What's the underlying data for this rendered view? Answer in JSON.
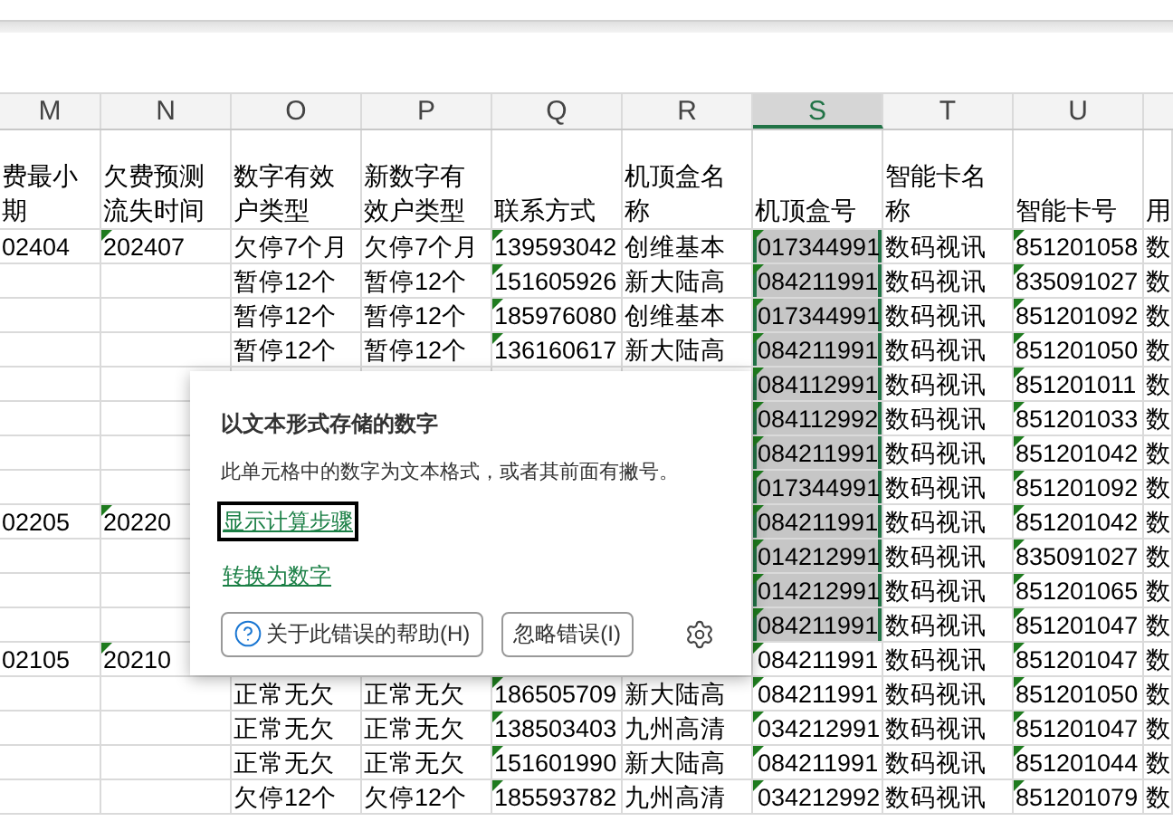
{
  "columns": [
    {
      "letter": "M",
      "header": [
        "费最小",
        "期"
      ],
      "selected": false
    },
    {
      "letter": "N",
      "header": [
        "欠费预测",
        "流失时间"
      ],
      "error_mark": true,
      "selected": false
    },
    {
      "letter": "O",
      "header": [
        "数字有效",
        "户类型"
      ],
      "selected": false
    },
    {
      "letter": "P",
      "header": [
        "新数字有",
        "效户类型"
      ],
      "selected": false
    },
    {
      "letter": "Q",
      "header": [
        "联系方式"
      ],
      "error_mark": true,
      "selected": false
    },
    {
      "letter": "R",
      "header": [
        "机顶盒名",
        "称"
      ],
      "selected": false
    },
    {
      "letter": "S",
      "header": [
        "机顶盒号"
      ],
      "error_mark": true,
      "selected": true
    },
    {
      "letter": "T",
      "header": [
        "智能卡名",
        "称"
      ],
      "selected": false
    },
    {
      "letter": "U",
      "header": [
        "智能卡号"
      ],
      "error_mark": true,
      "selected": false
    },
    {
      "header": [
        "用"
      ]
    }
  ],
  "rows": [
    {
      "selected": true,
      "cells": [
        "02404",
        "202407",
        "欠停7个月",
        "欠停7个月",
        "139593042",
        "创维基本",
        "017344991",
        "数码视讯",
        "851201058",
        "数"
      ]
    },
    {
      "selected": true,
      "cells": [
        null,
        null,
        "暂停12个",
        "暂停12个",
        "151605926",
        "新大陆高",
        "084211991",
        "数码视讯",
        "835091027",
        "数"
      ]
    },
    {
      "selected": true,
      "cells": [
        null,
        null,
        "暂停12个",
        "暂停12个",
        "185976080",
        "创维基本",
        "017344991",
        "数码视讯",
        "851201092",
        "数"
      ]
    },
    {
      "selected": true,
      "cells": [
        null,
        null,
        "暂停12个",
        "暂停12个",
        "136160617",
        "新大陆高",
        "084211991",
        "数码视讯",
        "851201050",
        "数"
      ]
    },
    {
      "selected": true,
      "cells": [
        null,
        null,
        null,
        null,
        null,
        null,
        "084112991",
        "数码视讯",
        "851201011",
        "数"
      ]
    },
    {
      "selected": true,
      "cells": [
        null,
        null,
        null,
        null,
        null,
        null,
        "084112992",
        "数码视讯",
        "851201033",
        "数"
      ]
    },
    {
      "selected": true,
      "cells": [
        null,
        null,
        null,
        null,
        null,
        null,
        "084211991",
        "数码视讯",
        "851201042",
        "数"
      ]
    },
    {
      "selected": true,
      "cells": [
        null,
        null,
        null,
        null,
        null,
        null,
        "017344991",
        "数码视讯",
        "851201092",
        "数"
      ]
    },
    {
      "selected": true,
      "cells": [
        "02205",
        "20220",
        null,
        null,
        null,
        null,
        "084211991",
        "数码视讯",
        "851201042",
        "数"
      ]
    },
    {
      "selected": true,
      "cells": [
        null,
        null,
        null,
        null,
        null,
        null,
        "014212991",
        "数码视讯",
        "835091027",
        "数"
      ]
    },
    {
      "selected": true,
      "cells": [
        null,
        null,
        null,
        null,
        null,
        null,
        "014212991",
        "数码视讯",
        "851201065",
        "数"
      ]
    },
    {
      "selected": true,
      "cells": [
        null,
        null,
        null,
        null,
        null,
        null,
        "084211991",
        "数码视讯",
        "851201047",
        "数"
      ]
    },
    {
      "selected": false,
      "cells": [
        "02105",
        "20210",
        null,
        null,
        null,
        null,
        "084211991",
        "数码视讯",
        "851201047",
        "数"
      ]
    },
    {
      "selected": false,
      "cells": [
        null,
        null,
        "正常无欠",
        "正常无欠",
        "186505709",
        "新大陆高",
        "084211991",
        "数码视讯",
        "851201050",
        "数"
      ]
    },
    {
      "selected": false,
      "cells": [
        null,
        null,
        "正常无欠",
        "正常无欠",
        "138503403",
        "九州高清",
        "034212991",
        "数码视讯",
        "851201047",
        "数"
      ]
    },
    {
      "selected": false,
      "cells": [
        null,
        null,
        "正常无欠",
        "正常无欠",
        "151601990",
        "新大陆高",
        "084211991",
        "数码视讯",
        "851201044",
        "数"
      ]
    },
    {
      "selected": false,
      "cells": [
        null,
        null,
        "欠停12个",
        "欠停12个",
        "185593782",
        "九州高清",
        "034212992",
        "数码视讯",
        "851201079",
        "数"
      ]
    }
  ],
  "error_popup": {
    "title": "以文本形式存储的数字",
    "description": "此单元格中的数字为文本格式，或者其前面有撇号。",
    "links": [
      {
        "label": "显示计算步骤",
        "focused": true
      },
      {
        "label": "转换为数字",
        "focused": false
      }
    ],
    "buttons": [
      {
        "kind": "help",
        "label": "关于此错误的帮助(H)"
      },
      {
        "kind": "plain",
        "label": "忽略错误(I)"
      }
    ]
  }
}
